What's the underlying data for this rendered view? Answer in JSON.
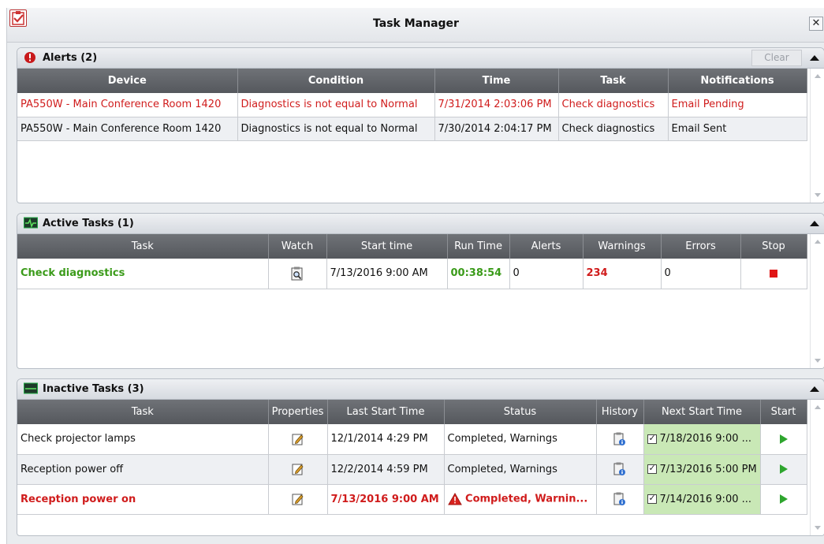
{
  "window": {
    "title": "Task Manager",
    "close_label": "✕"
  },
  "alerts": {
    "title": "Alerts (2)",
    "clear_label": "Clear",
    "columns": [
      "Device",
      "Condition",
      "Time",
      "Task",
      "Notifications"
    ],
    "rows": [
      {
        "device": "PA550W - Main Conference Room 1420",
        "condition": "Diagnostics  is not equal to Normal",
        "time": "7/31/2014 2:03:06 PM",
        "task": "Check diagnostics",
        "notifications": "Email Pending"
      },
      {
        "device": "PA550W - Main Conference Room 1420",
        "condition": "Diagnostics  is not equal to Normal",
        "time": "7/30/2014 2:04:17 PM",
        "task": "Check diagnostics",
        "notifications": "Email Sent"
      }
    ]
  },
  "active": {
    "title": "Active Tasks (1)",
    "columns": [
      "Task",
      "Watch",
      "Start time",
      "Run Time",
      "Alerts",
      "Warnings",
      "Errors",
      "Stop"
    ],
    "rows": [
      {
        "task": "Check diagnostics",
        "start_time": "7/13/2016 9:00 AM",
        "run_time": "00:38:54",
        "alerts": "0",
        "warnings": "234",
        "errors": "0"
      }
    ]
  },
  "inactive": {
    "title": "Inactive Tasks (3)",
    "columns": [
      "Task",
      "Properties",
      "Last Start Time",
      "Status",
      "History",
      "Next Start Time",
      "Start"
    ],
    "rows": [
      {
        "task": "Check projector lamps",
        "last_start": "12/1/2014 4:29 PM",
        "status": "Completed, Warnings",
        "next_start": "7/18/2016 9:00 ..."
      },
      {
        "task": "Reception power off",
        "last_start": "12/2/2014 4:59 PM",
        "status": "Completed, Warnings",
        "next_start": "7/13/2016 5:00 PM"
      },
      {
        "task": "Reception power on",
        "last_start": "7/13/2016 9:00 AM",
        "status": "Completed, Warnin...",
        "next_start": "7/14/2016 9:00 ..."
      }
    ]
  },
  "colors": {
    "alert_red": "#d01c1c",
    "running_green": "#3b9b1a",
    "next_start_bg": "#c9e8b6",
    "header_gray": "#626569"
  },
  "icons": [
    "app-checklist-icon",
    "alert-exclamation-icon",
    "activity-monitor-icon",
    "inactive-monitor-icon",
    "watch-magnifier-icon",
    "stop-icon",
    "properties-edit-icon",
    "history-info-icon",
    "warning-triangle-icon",
    "checkbox-icon",
    "play-icon",
    "collapse-arrow-icon"
  ]
}
